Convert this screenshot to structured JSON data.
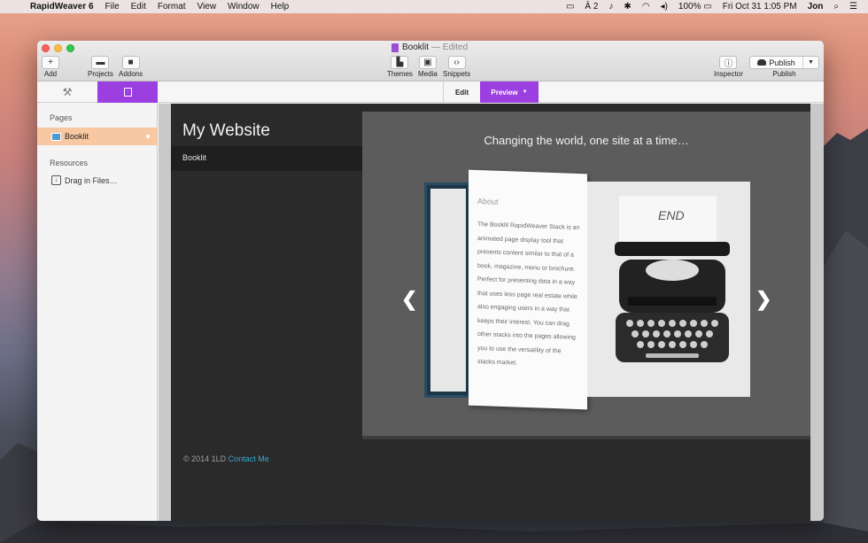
{
  "menubar": {
    "app": "RapidWeaver 6",
    "items": [
      "File",
      "Edit",
      "Format",
      "View",
      "Window",
      "Help"
    ],
    "status": {
      "adobe_count": "2",
      "battery": "100%",
      "datetime": "Fri Oct 31  1:05 PM",
      "user": "Jon"
    }
  },
  "window": {
    "title": "Booklit",
    "edited": "— Edited",
    "toolbar": {
      "add": "Add",
      "projects": "Projects",
      "addons": "Addons",
      "themes": "Themes",
      "media": "Media",
      "snippets": "Snippets",
      "inspector": "Inspector",
      "publish": "Publish",
      "publish_label": "Publish"
    },
    "modes": {
      "edit": "Edit",
      "preview": "Preview"
    }
  },
  "sidebar": {
    "pages_header": "Pages",
    "page_item": "Booklit",
    "resources_header": "Resources",
    "drag_files": "Drag in Files…"
  },
  "site": {
    "title": "My Website",
    "nav_item": "Booklit",
    "tagline": "Changing the world, one site at a time…",
    "book": {
      "heading": "About",
      "body": "The Booklit RapidWeaver Stack is an animated page display tool that presents content similar to that of a book, magazine, menu or brochure. Perfect for presenting data in a way that uses less page real estate while also engaging users in a way that keeps their interest. You can drag other stacks into the pages allowing you to use the versatility of the stacks market.",
      "paper_text": "END"
    },
    "footer": {
      "copyright": "© 2014 1LD",
      "link": "Contact Me"
    }
  },
  "colors": {
    "accent": "#9b3fe0",
    "selection": "#f7c8a1",
    "link": "#35a9d6"
  }
}
